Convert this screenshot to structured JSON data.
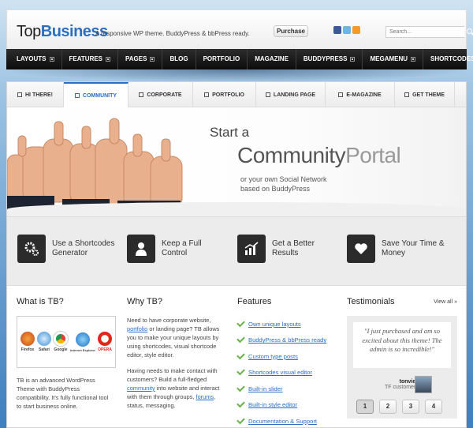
{
  "header": {
    "logo_part1": "Top",
    "logo_part2": "Business",
    "tagline": "A responsive WP theme. BuddyPress & bbPress ready.",
    "purchase_label": "Purchase",
    "search_placeholder": "Search...",
    "social_icons": [
      "facebook-icon",
      "twitter-icon",
      "rss-icon"
    ]
  },
  "nav": {
    "items": [
      "LAYOUTS",
      "FEATURES",
      "PAGES",
      "BLOG",
      "PORTFOLIO",
      "MAGAZINE",
      "BUDDYPRESS",
      "MEGAMENU",
      "SHORTCODES"
    ],
    "has_caret": [
      true,
      true,
      true,
      false,
      false,
      false,
      true,
      true,
      true
    ]
  },
  "tabs": {
    "items": [
      "HI THERE!",
      "COMMUNITY",
      "CORPORATE",
      "PORTFOLIO",
      "LANDING PAGE",
      "E-MAGAZINE",
      "GET THEME"
    ],
    "active_index": 1
  },
  "hero": {
    "start": "Start a",
    "title_part1": "Community",
    "title_part2": "Portal",
    "subtitle": "or your own Social Network based on BuddyPress"
  },
  "features": [
    {
      "text": "Use a Shortcodes Generator",
      "icon": "gears-icon"
    },
    {
      "text": "Keep a Full Control",
      "icon": "user-icon"
    },
    {
      "text": "Get a Better Results",
      "icon": "chart-icon"
    },
    {
      "text": "Save Your Time & Money",
      "icon": "heart-icon"
    }
  ],
  "what": {
    "heading": "What is TB?",
    "browsers": [
      "Firefox",
      "Safari",
      "Google",
      "Internet Explorer",
      "OPERA"
    ],
    "text": "TB is an advanced WordPress Theme with BuddyPress compatibility. It's fully functional tool to start business online."
  },
  "why": {
    "heading": "Why TB?",
    "p1_before": "Need to have corporate website, ",
    "p1_link": "portfolio",
    "p1_after": " or landing page? TB allows you to make your unique layouts by using shortcodes, visual shortcode editor, style editor.",
    "p2_before": "Having needs to make contact with customers? Build a full-fledged ",
    "p2_link1": "community",
    "p2_mid": " into website and interact with them through groups, ",
    "p2_link2": "forums",
    "p2_after": ", status, messaging."
  },
  "featureslist": {
    "heading": "Features",
    "items": [
      "Own unique layouts",
      "BuddyPress & bbPress ready",
      "Custom type posts",
      "Shortcodes visual editor",
      "Built-in slider",
      "Built-in style editor",
      "Documentation & Support"
    ]
  },
  "testimonials": {
    "heading": "Testimonials",
    "view_all": "View all »",
    "quote": "\"I just purchased and am so excited about this theme! The admin is so incredible!\"",
    "author": "tonvie",
    "role": "TF customer",
    "pages": [
      "1",
      "2",
      "3",
      "4"
    ],
    "active_page": 0
  }
}
